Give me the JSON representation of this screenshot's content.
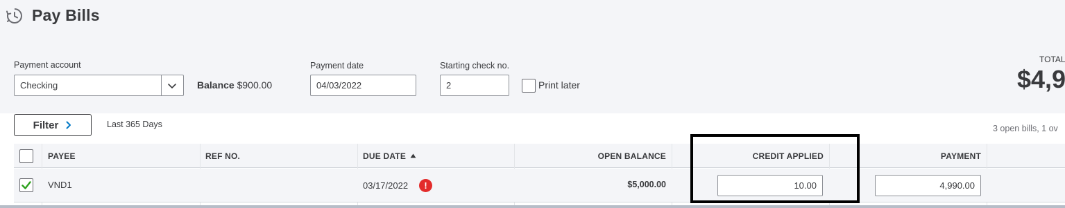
{
  "header": {
    "title": "Pay Bills",
    "icon": "clock-payment-icon"
  },
  "form": {
    "payment_account_label": "Payment account",
    "payment_account_value": "Checking",
    "balance_label": "Balance",
    "balance_value": "$900.00",
    "payment_date_label": "Payment date",
    "payment_date_value": "04/03/2022",
    "starting_check_label": "Starting check no.",
    "starting_check_value": "2",
    "print_later_label": "Print later",
    "print_later_checked": false
  },
  "total": {
    "label": "TOTAL",
    "value": "$4,9"
  },
  "toolbar": {
    "filter_label": "Filter",
    "date_range": "Last 365 Days",
    "open_bills_summary": "3 open bills, 1 ov"
  },
  "table": {
    "columns": {
      "payee": "PAYEE",
      "ref_no": "REF NO.",
      "due_date": "DUE DATE",
      "open_balance": "OPEN BALANCE",
      "credit_applied": "CREDIT APPLIED",
      "payment": "PAYMENT"
    },
    "sort": {
      "column": "due_date",
      "direction": "ascending"
    },
    "rows": [
      {
        "selected": true,
        "payee": "VND1",
        "ref_no": "",
        "due_date": "03/17/2022",
        "overdue_icon": "!",
        "open_balance": "$5,000.00",
        "credit_applied": "10.00",
        "payment": "4,990.00"
      }
    ]
  },
  "colors": {
    "page_bg": "#f4f5f8",
    "text": "#393a3d",
    "overdue_red": "#e32b2b",
    "check_green": "#2ca01c",
    "highlight": "#000000"
  }
}
